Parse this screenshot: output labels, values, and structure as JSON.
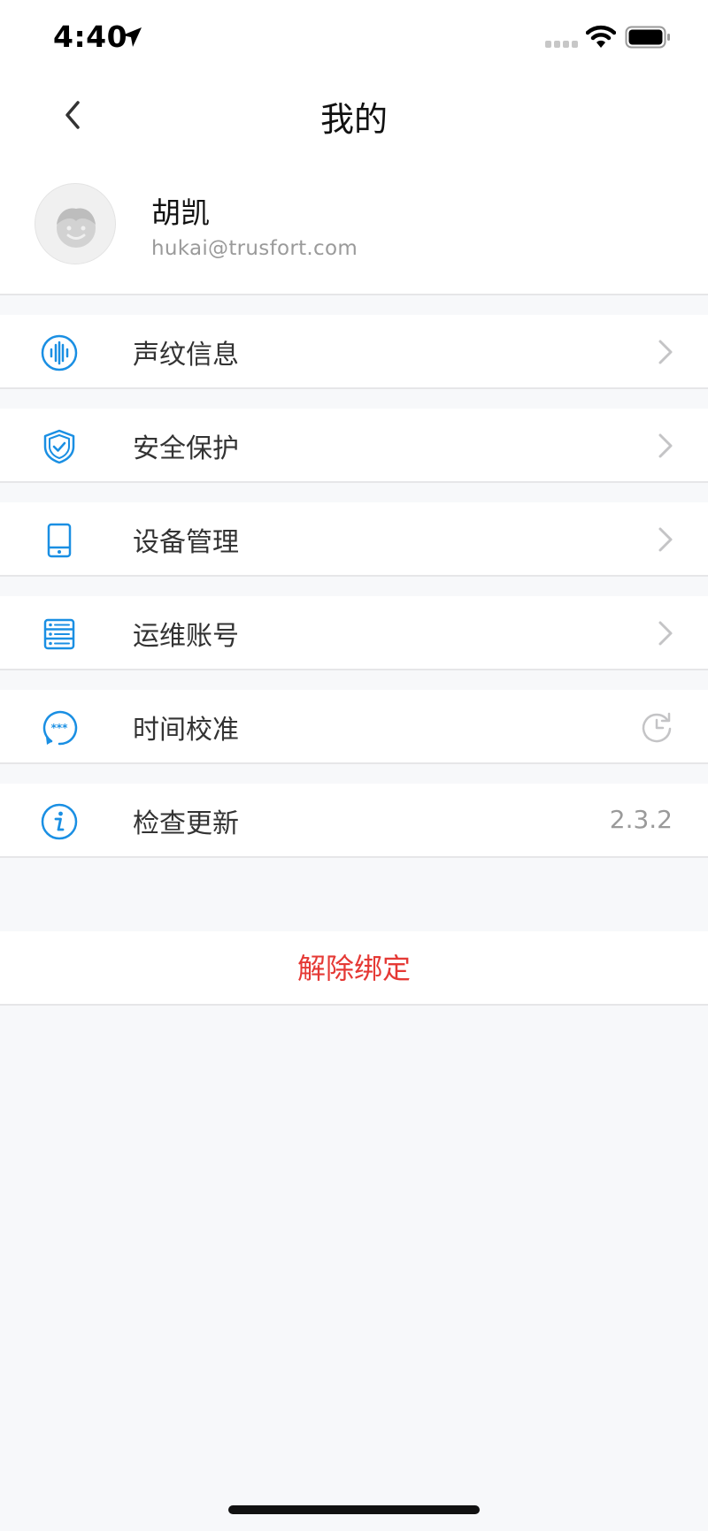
{
  "status_bar": {
    "time": "4:40"
  },
  "nav": {
    "title": "我的"
  },
  "profile": {
    "name": "胡凯",
    "email": "hukai@trusfort.com"
  },
  "menu": [
    {
      "label": "声纹信息",
      "icon": "voiceprint-icon",
      "trailing": "chevron"
    },
    {
      "label": "安全保护",
      "icon": "shield-check-icon",
      "trailing": "chevron"
    },
    {
      "label": "设备管理",
      "icon": "device-tablet-icon",
      "trailing": "chevron"
    },
    {
      "label": "运维账号",
      "icon": "server-list-icon",
      "trailing": "chevron"
    },
    {
      "label": "时间校准",
      "icon": "time-sync-icon",
      "trailing": "sync"
    },
    {
      "label": "检查更新",
      "icon": "info-icon",
      "trailing": "value",
      "value": "2.3.2"
    }
  ],
  "unbind_label": "解除绑定",
  "colors": {
    "accent": "#1a8fe3",
    "danger": "#e53935",
    "background": "#f7f8fa"
  }
}
